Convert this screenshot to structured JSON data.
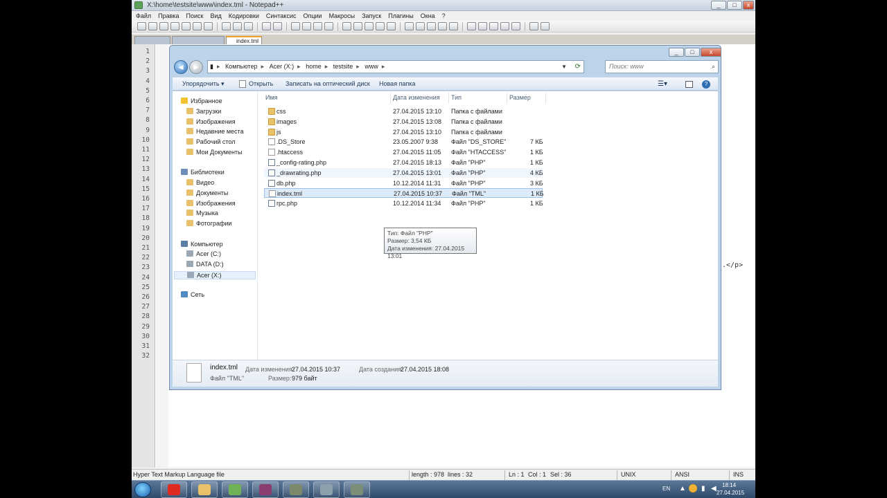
{
  "npp": {
    "title": "X:\\home\\testsite\\www\\index.tml - Notepad++",
    "menu": [
      "Файл",
      "Правка",
      "Поиск",
      "Вид",
      "Кодировки",
      "Синтаксис",
      "Опции",
      "Макросы",
      "Запуск",
      "Плагины",
      "Окна",
      "?"
    ],
    "tabs": [
      "",
      "",
      "index.tml"
    ],
    "line_numbers": [
      "1",
      "2",
      "3",
      "4",
      "5",
      "6",
      "7",
      "8",
      "9",
      "10",
      "11",
      "12",
      "13",
      "14",
      "15",
      "16",
      "17",
      "18",
      "19",
      "20",
      "21",
      "22",
      "23",
      "24",
      "25",
      "26",
      "27",
      "28",
      "29",
      "30",
      "31",
      "32"
    ],
    "code_fragment": ".</p>",
    "status": {
      "filetype": "Hyper Text Markup Language file",
      "length": "length : 978",
      "lines": "lines : 32",
      "ln": "Ln : 1",
      "col": "Col : 1",
      "sel": "Sel : 36",
      "eol": "UNIX",
      "encoding": "ANSI",
      "mode": "INS"
    }
  },
  "explorer": {
    "breadcrumb": [
      "Компьютер",
      "Acer (X:)",
      "home",
      "testsite",
      "www"
    ],
    "search_placeholder": "Поиск: www",
    "commands": {
      "organize": "Упорядочить ▾",
      "open": "Открыть",
      "burn": "Записать на оптический диск",
      "new_folder": "Новая папка"
    },
    "nav": [
      {
        "label": "Избранное",
        "kind": "star",
        "level": 0
      },
      {
        "label": "Загрузки",
        "kind": "folder",
        "level": 1
      },
      {
        "label": "Изображения",
        "kind": "folder",
        "level": 1
      },
      {
        "label": "Недавние места",
        "kind": "folder",
        "level": 1
      },
      {
        "label": "Рабочий стол",
        "kind": "folder",
        "level": 1
      },
      {
        "label": "Мои Документы",
        "kind": "folder",
        "level": 1
      },
      {
        "label": "Библиотеки",
        "kind": "lib",
        "level": 0
      },
      {
        "label": "Видео",
        "kind": "folder",
        "level": 1
      },
      {
        "label": "Документы",
        "kind": "folder",
        "level": 1
      },
      {
        "label": "Изображения",
        "kind": "folder",
        "level": 1
      },
      {
        "label": "Музыка",
        "kind": "folder",
        "level": 1
      },
      {
        "label": "Фотографии",
        "kind": "folder",
        "level": 1
      },
      {
        "label": "Компьютер",
        "kind": "pc",
        "level": 0
      },
      {
        "label": "Acer (C:)",
        "kind": "drive",
        "level": 1
      },
      {
        "label": "DATA (D:)",
        "kind": "drive",
        "level": 1
      },
      {
        "label": "Acer (X:)",
        "kind": "drive",
        "level": 1,
        "selected": true
      },
      {
        "label": "Сеть",
        "kind": "net",
        "level": 0
      }
    ],
    "columns": [
      "Имя",
      "Дата изменения",
      "Тип",
      "Размер"
    ],
    "files": [
      {
        "name": "css",
        "date": "27.04.2015 13:10",
        "type": "Папка с файлами",
        "size": "",
        "icon": "folder"
      },
      {
        "name": "images",
        "date": "27.04.2015 13:08",
        "type": "Папка с файлами",
        "size": "",
        "icon": "folder"
      },
      {
        "name": "js",
        "date": "27.04.2015 13:10",
        "type": "Папка с файлами",
        "size": "",
        "icon": "folder"
      },
      {
        "name": ".DS_Store",
        "date": "23.05.2007 9:38",
        "type": "Файл \"DS_STORE\"",
        "size": "7 КБ",
        "icon": "file"
      },
      {
        "name": ".htaccess",
        "date": "27.04.2015 11:05",
        "type": "Файл \"HTACCESS\"",
        "size": "1 КБ",
        "icon": "file"
      },
      {
        "name": "_config-rating.php",
        "date": "27.04.2015 18:13",
        "type": "Файл \"PHP\"",
        "size": "1 КБ",
        "icon": "php"
      },
      {
        "name": "_drawrating.php",
        "date": "27.04.2015 13:01",
        "type": "Файл \"PHP\"",
        "size": "4 КБ",
        "icon": "php",
        "hover": true
      },
      {
        "name": "db.php",
        "date": "10.12.2014 11:31",
        "type": "Файл \"PHP\"",
        "size": "3 КБ",
        "icon": "php"
      },
      {
        "name": "index.tml",
        "date": "27.04.2015 10:37",
        "type": "Файл \"TML\"",
        "size": "1 КБ",
        "icon": "file",
        "selected": true
      },
      {
        "name": "rpc.php",
        "date": "10.12.2014 11:34",
        "type": "Файл \"PHP\"",
        "size": "1 КБ",
        "icon": "php"
      }
    ],
    "tooltip": [
      "Тип: Файл \"PHP\"",
      "Размер: 3,54 КБ",
      "Дата изменения: 27.04.2015 13:01"
    ],
    "details": {
      "name": "index.tml",
      "type": "Файл \"TML\"",
      "modified_label": "Дата изменения:",
      "modified": "27.04.2015 10:37",
      "created_label": "Дата создания:",
      "created": "27.04.2015 18:08",
      "size_label": "Размер:",
      "size": "979 байт"
    }
  },
  "taskbar": {
    "lang": "EN",
    "time": "18:14",
    "date": "27.04.2015"
  },
  "colors": {
    "accent": "#2e6fb7",
    "selection": "#dceafa",
    "folder": "#e8c16a"
  }
}
